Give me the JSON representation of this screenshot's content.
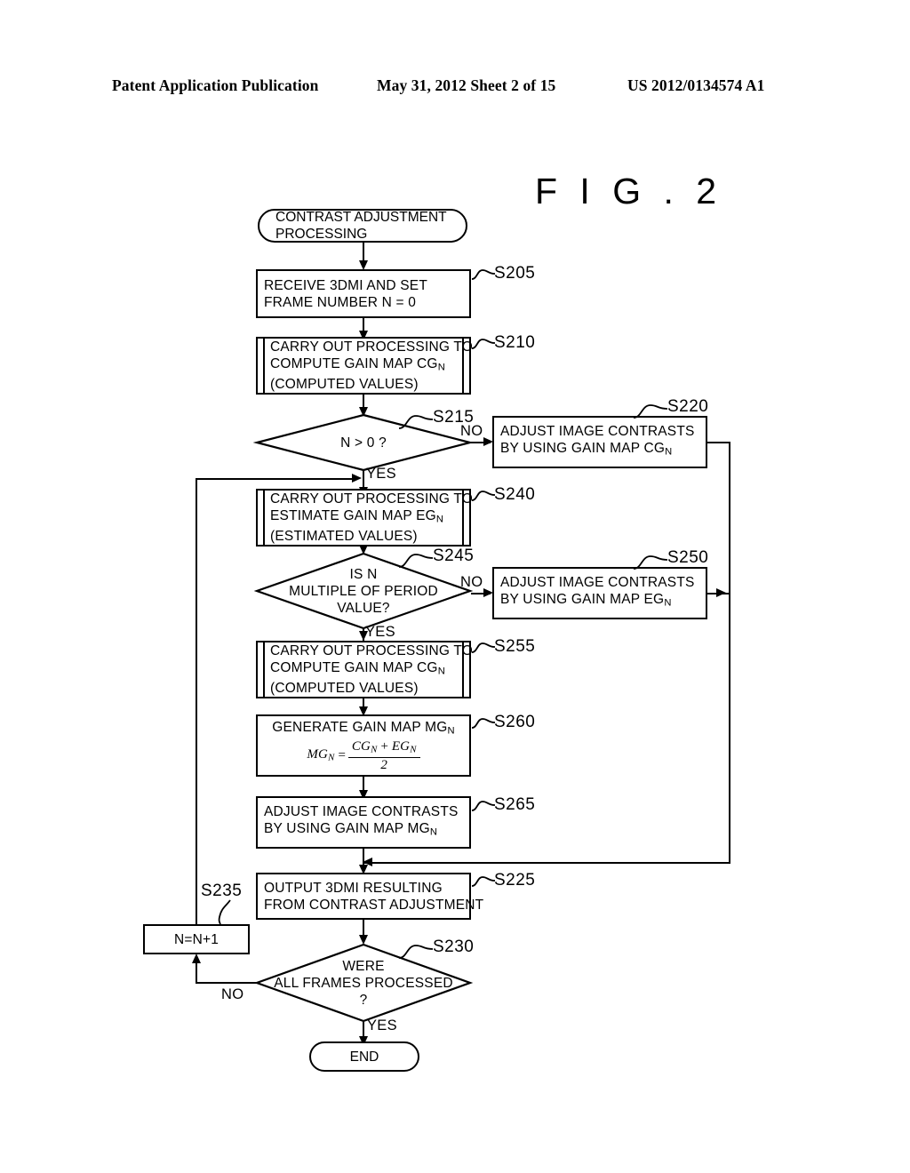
{
  "header": {
    "left": "Patent Application Publication",
    "center": "May 31, 2012  Sheet 2 of 15",
    "right": "US 2012/0134574 A1"
  },
  "figure": {
    "title": "F I G . 2"
  },
  "nodes": {
    "start": {
      "id": "start",
      "shape": "terminator",
      "line1": "CONTRAST ADJUSTMENT",
      "line2": "PROCESSING"
    },
    "s205": {
      "ref": "S205",
      "shape": "process",
      "line1": "RECEIVE 3DMI AND SET",
      "line2": "FRAME NUMBER N = 0"
    },
    "s210": {
      "ref": "S210",
      "shape": "predefined-process",
      "line1": "CARRY OUT PROCESSING TO",
      "line2": "COMPUTE GAIN MAP CG",
      "line2_sub": "N",
      "line3": "(COMPUTED VALUES)"
    },
    "s215": {
      "ref": "S215",
      "shape": "decision",
      "line1": "N > 0 ?",
      "yes": "YES",
      "no": "NO"
    },
    "s220": {
      "ref": "S220",
      "shape": "process",
      "line1": "ADJUST IMAGE CONTRASTS",
      "line2": "BY USING GAIN MAP CG",
      "line2_sub": "N"
    },
    "s240": {
      "ref": "S240",
      "shape": "predefined-process",
      "line1": "CARRY OUT PROCESSING TO",
      "line2": "ESTIMATE GAIN MAP EG",
      "line2_sub": "N",
      "line3": "(ESTIMATED VALUES)"
    },
    "s245": {
      "ref": "S245",
      "shape": "decision",
      "line1": "IS N",
      "line2": "MULTIPLE OF PERIOD",
      "line3": "VALUE?",
      "yes": "YES",
      "no": "NO"
    },
    "s250": {
      "ref": "S250",
      "shape": "process",
      "line1": "ADJUST IMAGE CONTRASTS",
      "line2": "BY USING GAIN MAP EG",
      "line2_sub": "N"
    },
    "s255": {
      "ref": "S255",
      "shape": "predefined-process",
      "line1": "CARRY OUT PROCESSING TO",
      "line2": "COMPUTE GAIN MAP CG",
      "line2_sub": "N",
      "line3": "(COMPUTED VALUES)"
    },
    "s260": {
      "ref": "S260",
      "shape": "process",
      "line1": "GENERATE GAIN MAP MG",
      "line1_sub": "N",
      "equation": {
        "lhs": "MG",
        "lhs_sub": "N",
        "eq": "=",
        "numerator_left": "CG",
        "numerator_left_sub": "N",
        "numerator_op": "+",
        "numerator_right": "EG",
        "numerator_right_sub": "N",
        "denominator": "2"
      }
    },
    "s265": {
      "ref": "S265",
      "shape": "process",
      "line1": "ADJUST IMAGE CONTRASTS",
      "line2": "BY USING GAIN MAP MG",
      "line2_sub": "N"
    },
    "s225": {
      "ref": "S225",
      "shape": "process",
      "line1": "OUTPUT 3DMI RESULTING",
      "line2": "FROM CONTRAST ADJUSTMENT"
    },
    "s230": {
      "ref": "S230",
      "shape": "decision",
      "line1": "WERE",
      "line2": "ALL FRAMES PROCESSED",
      "line3": "?",
      "yes": "YES",
      "no": "NO"
    },
    "s235": {
      "ref": "S235",
      "shape": "process",
      "line1": "N=N+1"
    },
    "end": {
      "id": "end",
      "shape": "terminator",
      "line1": "END"
    }
  },
  "colors": {
    "stroke": "#000000",
    "background": "#ffffff"
  }
}
